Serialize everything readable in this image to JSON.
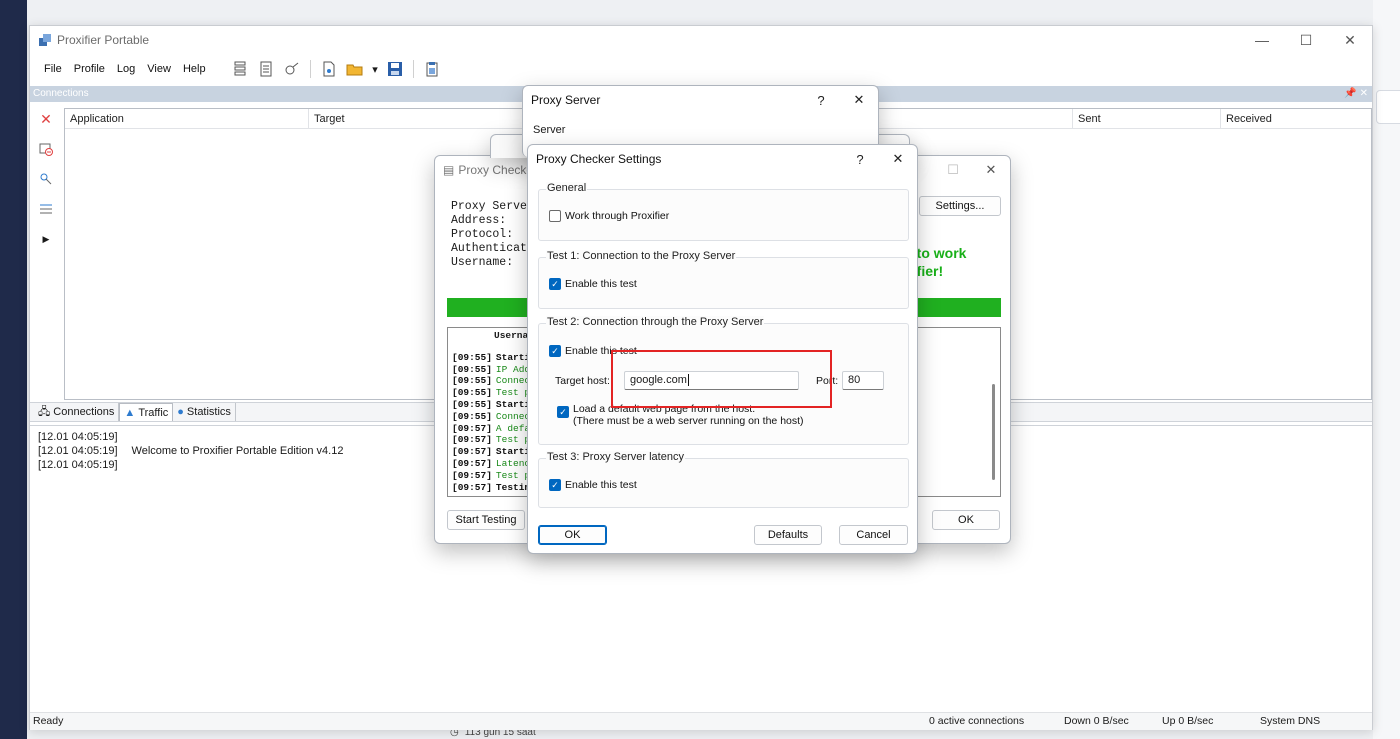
{
  "main_window": {
    "title": "Proxifier Portable",
    "menu": [
      "File",
      "Profile",
      "Log",
      "View",
      "Help"
    ],
    "panel_title": "Connections",
    "columns": [
      "Application",
      "Target",
      "Sent",
      "Received"
    ],
    "tabs": [
      "Connections",
      "Traffic",
      "Statistics"
    ],
    "log": [
      {
        "time": "[12.01 04:05:19]",
        "msg": ""
      },
      {
        "time": "[12.01 04:05:19]",
        "msg": "Welcome to Proxifier Portable Edition v4.12"
      },
      {
        "time": "[12.01 04:05:19]",
        "msg": ""
      }
    ],
    "status": {
      "state": "Ready",
      "connections": "0 active connections",
      "down": "Down 0 B/sec",
      "up": "Up 0 B/sec",
      "dns": "System DNS"
    }
  },
  "taskbar_hint": "113 gün 15 saat",
  "proxy_checker": {
    "title": "Proxy Checke",
    "info": "Proxy Server\nAddress:\nProtocol:\nAuthenticati\nUsername:",
    "ready_text": "y to work\nxifier!",
    "settings_button": "Settings...",
    "start_button": "Start Testing",
    "ok_button": "OK",
    "log_header": "Userna",
    "log": [
      {
        "t": "[09:55]",
        "m": "Starti",
        "color": "#111111"
      },
      {
        "t": "[09:55]",
        "m": "IP Add",
        "color": "#1a8a1a"
      },
      {
        "t": "[09:55]",
        "m": "Connec",
        "color": "#1a8a1a"
      },
      {
        "t": "[09:55]",
        "m": "Test p",
        "color": "#1a8a1a"
      },
      {
        "t": "[09:55]",
        "m": "Starti",
        "color": "#111111"
      },
      {
        "t": "[09:55]",
        "m": "Connec",
        "color": "#1a8a1a"
      },
      {
        "t": "[09:57]",
        "m": "A defa",
        "color": "#1a8a1a"
      },
      {
        "t": "[09:57]",
        "m": "Test p",
        "color": "#1a8a1a"
      },
      {
        "t": "[09:57]",
        "m": "Starti",
        "color": "#111111"
      },
      {
        "t": "[09:57]",
        "m": "Latenc",
        "color": "#1a8a1a"
      },
      {
        "t": "[09:57]",
        "m": "Test p",
        "color": "#1a8a1a"
      },
      {
        "t": "[09:57]",
        "m": "Testin",
        "color": "#111111"
      }
    ]
  },
  "proxy_server": {
    "title": "Proxy Server",
    "help": "?",
    "close": "✕",
    "group": "Server"
  },
  "settings": {
    "title": "Proxy Checker Settings",
    "help": "?",
    "close": "✕",
    "general": {
      "title": "General",
      "work_through": "Work through Proxifier",
      "work_through_checked": false
    },
    "test1": {
      "title": "Test 1: Connection to the Proxy Server",
      "enable": "Enable this test",
      "checked": true
    },
    "test2": {
      "title": "Test 2: Connection through the Proxy Server",
      "enable": "Enable this test",
      "checked": true,
      "host_label": "Target host:",
      "host_value": "google.com",
      "port_label": "Port:",
      "port_value": "80",
      "load_label": "Load a default web page from the host.",
      "load_note": "(There must be a web server running on the host)",
      "load_checked": true
    },
    "test3": {
      "title": "Test 3: Proxy Server latency",
      "enable": "Enable this test",
      "checked": true
    },
    "ok": "OK",
    "defaults": "Defaults",
    "cancel": "Cancel"
  },
  "colors": {
    "accent": "#0067c0",
    "highlight": "#e32424",
    "progress": "#20b020"
  }
}
